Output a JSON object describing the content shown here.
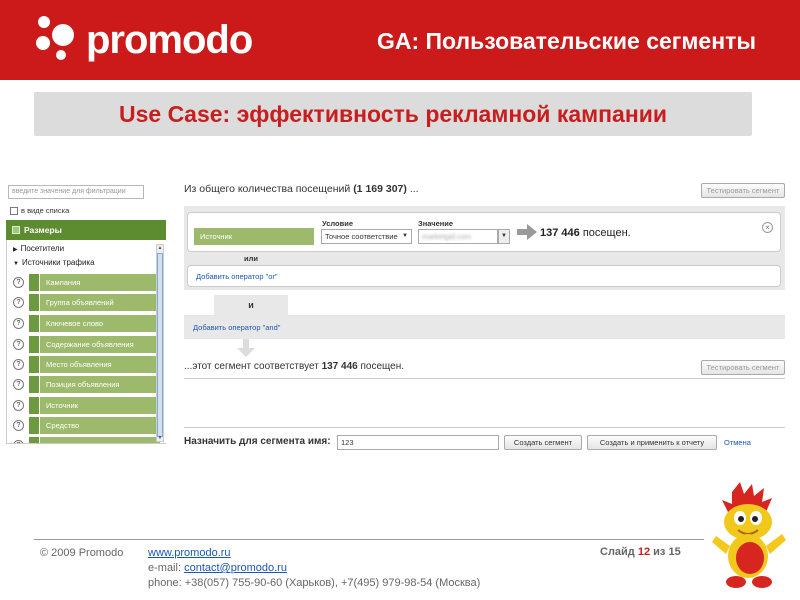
{
  "header": {
    "logo_text": "promodo",
    "title": "GA: Пользовательские сегменты",
    "bg_color": "#cc1a1a"
  },
  "banner": {
    "text": "Use Case: эффективность рекламной кампании"
  },
  "left_panel": {
    "filter_placeholder": "введите значение для фильтрации",
    "list_view_label": "в виде списка",
    "dimensions_header": "Размеры",
    "tree": [
      {
        "label": "Посетители",
        "expanded": false
      },
      {
        "label": "Источники трафика",
        "expanded": true
      }
    ],
    "items": [
      "Кампания",
      "Группа объявлений",
      "Ключевое слово",
      "Содержание объявления",
      "Место объявления",
      "Позиция объявления",
      "Источник",
      "Средство",
      ""
    ],
    "accent_color": "#5d8b2f",
    "pill_color": "#9dba6c"
  },
  "builder": {
    "intro_prefix": "Из общего количества посещений",
    "intro_count": "(1 169 307)",
    "intro_suffix": "...",
    "test_button": "Тестировать сегмент",
    "condition_label": "Условие",
    "value_label": "Значение",
    "dimension": "Источник",
    "condition": "Точное соответствие",
    "value": "marketgid.com",
    "match_count": "137 446",
    "match_suffix": "посещен.",
    "or_label": "или",
    "add_or": "Добавить оператор \"or\"",
    "and_label": "и",
    "add_and": "Добавить оператор \"and\"",
    "result_prefix": "...этот сегмент соответствует",
    "result_count": "137 446",
    "result_suffix": "посещен.",
    "test_button_2": "Тестировать сегмент"
  },
  "assign": {
    "label": "Назначить для сегмента имя:",
    "name_value": "123",
    "create_button": "Создать сегмент",
    "create_apply_button": "Создать и применить к отчету",
    "cancel_link": "Отмена"
  },
  "footer": {
    "copyright": "© 2009  Promodo",
    "website": "www.promodo.ru",
    "email_prefix": "e-mail:",
    "email": "contact@promodo.ru",
    "phone": "phone: +38(057) 755-90-60 (Харьков), +7(495) 979-98-54 (Москва)",
    "slide_prefix": "Слайд",
    "slide_current": "12",
    "slide_of": "из",
    "slide_total": "15"
  }
}
